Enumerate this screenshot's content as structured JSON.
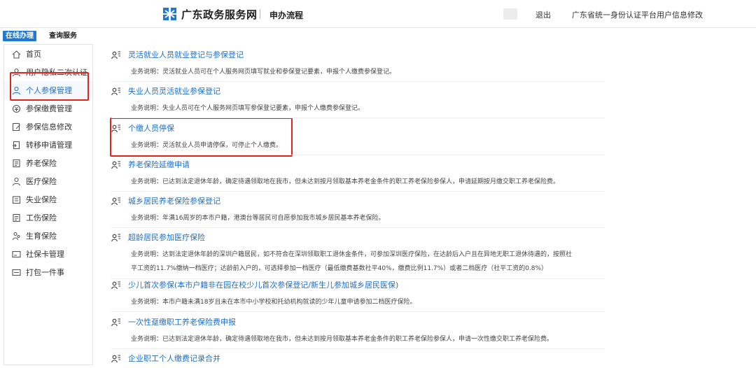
{
  "header": {
    "brand": "广东政务服务网",
    "subtitle": "申办流程",
    "logout": "退出",
    "user_link": "广东省统一身份认证平台用户信息修改",
    "brand_color": "#1f78d1"
  },
  "tabs": {
    "online": "在线办理",
    "query": "查询服务"
  },
  "sidebar": {
    "items": [
      {
        "label": "首页",
        "icon": "home-icon"
      },
      {
        "label": "用户隐私二次认证",
        "icon": "user-shield-icon"
      },
      {
        "label": "个人参保管理",
        "icon": "person-icon"
      },
      {
        "label": "参保缴费管理",
        "icon": "payment-icon"
      },
      {
        "label": "参保信息修改",
        "icon": "edit-icon"
      },
      {
        "label": "转移申请管理",
        "icon": "transfer-icon"
      },
      {
        "label": "养老保险",
        "icon": "document-icon"
      },
      {
        "label": "医疗保险",
        "icon": "medical-icon"
      },
      {
        "label": "失业保险",
        "icon": "building-icon"
      },
      {
        "label": "工伤保险",
        "icon": "document-icon"
      },
      {
        "label": "生育保险",
        "icon": "family-icon"
      },
      {
        "label": "社保卡管理",
        "icon": "card-icon"
      },
      {
        "label": "打包一件事",
        "icon": "package-icon"
      }
    ]
  },
  "services": [
    {
      "title": "灵活就业人员就业登记与参保登记",
      "desc": [
        "业务说明：灵活就业人员可在个人服务网页填写就业和参保登记要素，申报个人缴费参保登记。"
      ]
    },
    {
      "title": "失业人员灵活就业参保登记",
      "desc": [
        "业务说明：失业人员可在个人服务网页填写参保登记要素，申报个人缴费参保登记。"
      ]
    },
    {
      "title": "个缴人员停保",
      "desc": [
        "业务说明：灵活就业人员申请停保，可停止个人缴费。"
      ]
    },
    {
      "title": "养老保险延缴申请",
      "desc": [
        "业务说明：已达到法定退休年龄，确定待遇领取地在我市，但未达到按月领取基本养老金条件的职工养老保险参保人，申请延期按月缴交职工养老保险费。"
      ]
    },
    {
      "title": "城乡居民养老保险参保登记",
      "desc": [
        "业务说明：年满16周岁的本市户籍，港澳台等居民可自愿参加我市城乡居民基本养老保险。"
      ]
    },
    {
      "title": "超龄居民参加医疗保险",
      "desc": [
        "业务说明：达到法定退休年龄的深圳户籍居民，如不符合在深圳领取职工退休金条件，可参加深圳医疗保险，在达龄后入户且在异地无职工退休待遇的，按照社",
        "平工资的11.7%缴纳一档医疗；达龄前入户的，可选择参加一档医疗（最低缴费基数社平40%，缴费比例11.7%）或者二档医疗（社平工资的0.8%）"
      ]
    },
    {
      "title": "少儿首次参保(本市户籍非在园在校少儿首次参保登记/新生儿参加城乡居民医保)",
      "desc": [
        "业务说明：本市户籍未满18岁且未在本市中小学校和托幼机构就读的少年儿童申请参加二档医疗保险。"
      ]
    },
    {
      "title": "一次性趸缴职工养老保险费申报",
      "desc": [
        "业务说明：已达到法定退休年龄，确定待遇领取地在我市，但未达到按月领取基本养老金条件的职工养老保险参保人，申请一次性缴交职工养老保险费。"
      ]
    },
    {
      "title": "企业职工个人缴费记录合并",
      "desc": []
    }
  ]
}
